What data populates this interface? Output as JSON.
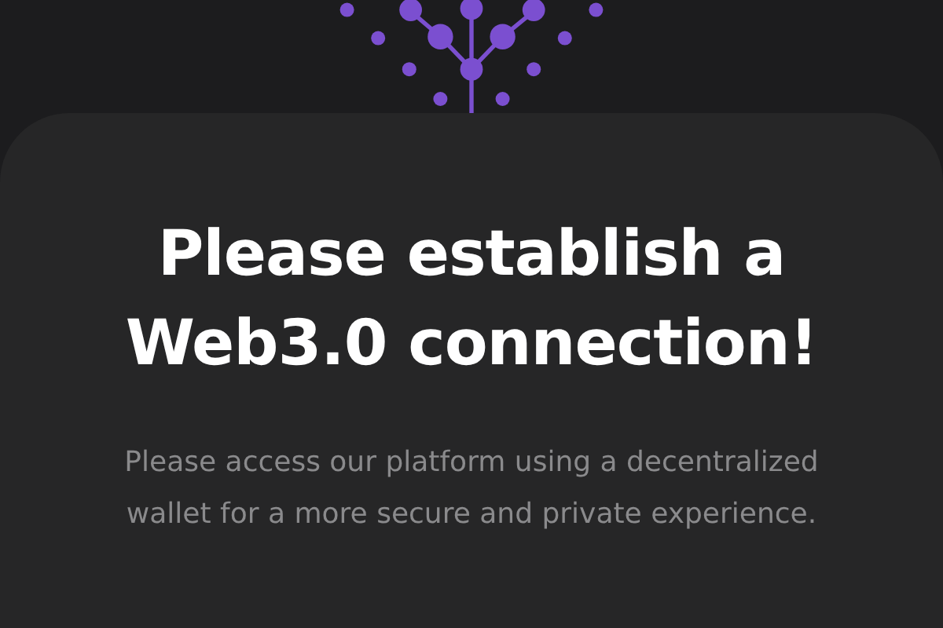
{
  "title": "Please establish a Web3.0 connection!",
  "description": "Please access our platform using a decentralized wallet for a more secure and private experience."
}
